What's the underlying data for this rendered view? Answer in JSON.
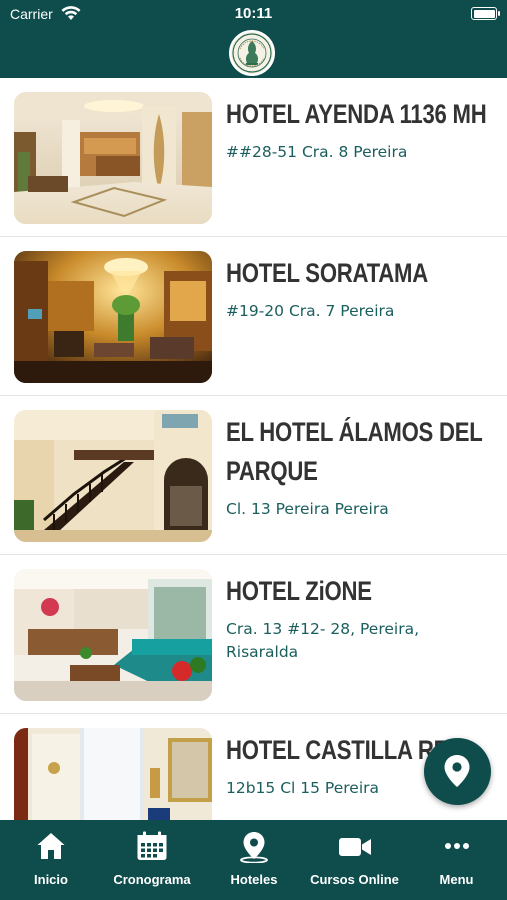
{
  "status_bar": {
    "carrier": "Carrier",
    "time": "10:11"
  },
  "header": {
    "logo_icon": "association-seal-logo"
  },
  "colors": {
    "primary": "#0f4c4c",
    "title_text": "#333333",
    "address_text": "#1b5e5e"
  },
  "hotels": [
    {
      "name": "HOTEL AYENDA 1136 MH",
      "address": "##28-51 Cra. 8 Pereira",
      "image": "hotel-lobby-photo"
    },
    {
      "name": "HOTEL SORATAMA",
      "address": "#19-20 Cra. 7 Pereira",
      "image": "hotel-lobby-photo"
    },
    {
      "name": "EL HOTEL ÁLAMOS DEL PARQUE",
      "address": "Cl. 13 Pereira Pereira",
      "image": "hotel-staircase-photo"
    },
    {
      "name": "HOTEL ZiONE",
      "address": "Cra. 13 #12- 28, Pereira, Risaralda",
      "image": "hotel-lounge-photo"
    },
    {
      "name": "HOTEL CASTILLA REAL",
      "address": "12b15 Cl 15 Pereira",
      "image": "hotel-room-photo"
    }
  ],
  "fab": {
    "icon": "map-pin-icon"
  },
  "tabbar": {
    "tabs": [
      {
        "label": "Inicio",
        "icon": "home-icon"
      },
      {
        "label": "Cronograma",
        "icon": "calendar-icon"
      },
      {
        "label": "Hoteles",
        "icon": "location-pin-icon"
      },
      {
        "label": "Cursos Online",
        "icon": "video-camera-icon"
      },
      {
        "label": "Menu",
        "icon": "more-dots-icon"
      }
    ]
  }
}
